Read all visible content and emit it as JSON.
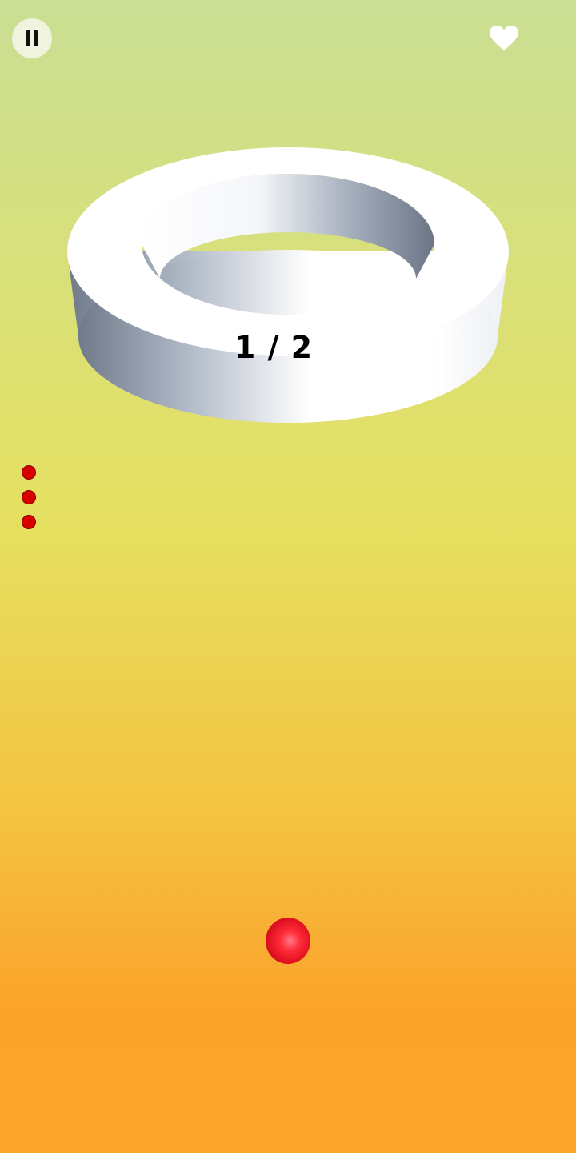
{
  "hud": {
    "pause_icon": "pause-icon",
    "lives_icon": "heart-icon",
    "lives_color": "#ffffff"
  },
  "level": {
    "progress_text": "1 / 2",
    "ring_color": "#ffffff",
    "ring_shadow_color": "#6e7888"
  },
  "balls_remaining": {
    "count": 3,
    "color": "#d70000"
  },
  "player_ball": {
    "color": "#ff2b3a"
  },
  "background": {
    "top_color": "#cadf94",
    "middle_color": "#e5e061",
    "bottom_color": "#fda52a"
  }
}
